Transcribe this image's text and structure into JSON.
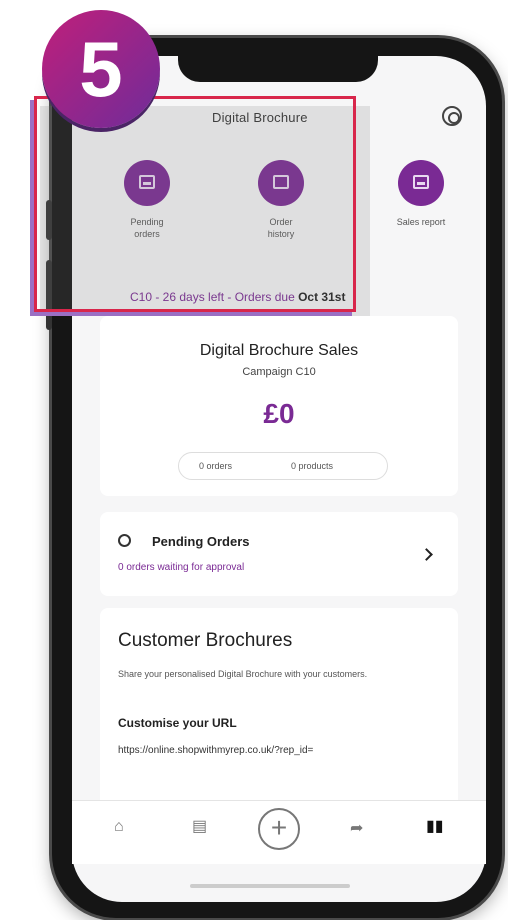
{
  "step_badge": "5",
  "app": {
    "title": "Digital Brochure"
  },
  "quick_actions": [
    {
      "label_line1": "Pending",
      "label_line2": "orders",
      "icon": "tray-icon"
    },
    {
      "label_line1": "Order",
      "label_line2": "history",
      "icon": "receipt-icon"
    },
    {
      "label_line1": "Sales report",
      "label_line2": "",
      "icon": "inbox-icon"
    }
  ],
  "campaign_banner": {
    "text": "C10 - 26 days left - Orders due ",
    "date": "Oct 31st"
  },
  "sales_card": {
    "title": "Digital Brochure Sales",
    "campaign": "Campaign C10",
    "amount": "£0",
    "orders_label": "0 orders",
    "products_label": "0 products"
  },
  "pending_card": {
    "title": "Pending Orders",
    "subtitle": "0 orders waiting for approval"
  },
  "customer_brochures": {
    "title": "Customer Brochures",
    "description": "Share your personalised Digital Brochure with your customers.",
    "customise_heading": "Customise your URL",
    "url": "https://online.shopwithmyrep.co.uk/?rep_id="
  },
  "colors": {
    "accent": "#7a2a94",
    "highlight_frame": "#d8264b",
    "badge_from": "#c01f7a",
    "badge_to": "#6f2c9a"
  }
}
